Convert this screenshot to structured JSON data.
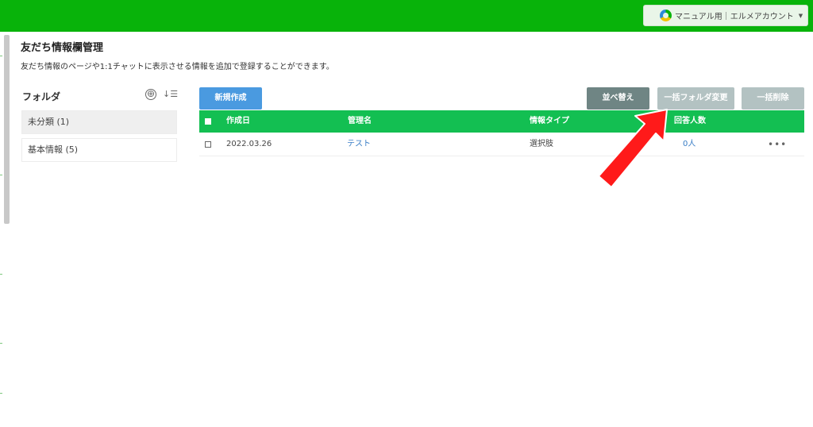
{
  "header": {
    "account_label": "マニュアル用｜エルメアカウント",
    "caret": "▼"
  },
  "page": {
    "title": "友だち情報欄管理",
    "description": "友だち情報のページや1:1チャットに表示させる情報を追加で登録することができます。"
  },
  "folders": {
    "heading": "フォルダ",
    "add_icon": "⊕",
    "sort_icon": "↓☰",
    "items": [
      {
        "label": "未分類 (1)"
      },
      {
        "label": "基本情報 (5)"
      }
    ]
  },
  "toolbar": {
    "new_label": "新規作成",
    "sort_label": "並べ替え",
    "bulk_folder_label": "一括フォルダ変更",
    "bulk_delete_label": "一括削除"
  },
  "table": {
    "columns": [
      "作成日",
      "管理名",
      "情報タイプ",
      "回答人数"
    ],
    "rows": [
      {
        "created": "2022.03.26",
        "name": "テスト",
        "type": "選択肢",
        "answers": "0人",
        "menu": "•••"
      }
    ]
  },
  "colors": {
    "topbar": "#08b30a",
    "table_header": "#13bf52",
    "new_button": "#4a9ae0",
    "sort_button": "#6f8584",
    "disabled_button": "#b3c2c2",
    "annotation_arrow": "#ff1a1a"
  }
}
